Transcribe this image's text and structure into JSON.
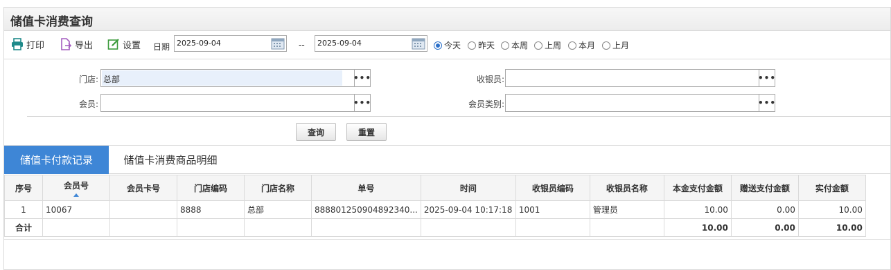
{
  "page": {
    "title": "储值卡消费查询"
  },
  "toolbar": {
    "print_label": "打印",
    "export_label": "导出",
    "settings_label": "设置",
    "date_label": "日期",
    "date_from": "2025-09-04",
    "date_separator": "--",
    "date_to": "2025-09-04",
    "ranges": [
      {
        "label": "今天",
        "selected": true
      },
      {
        "label": "昨天",
        "selected": false
      },
      {
        "label": "本周",
        "selected": false
      },
      {
        "label": "上周",
        "selected": false
      },
      {
        "label": "本月",
        "selected": false
      },
      {
        "label": "上月",
        "selected": false
      }
    ],
    "more_glyph": "•••"
  },
  "filters": {
    "store_label": "门店:",
    "store_value": "总部",
    "cashier_label": "收银员:",
    "cashier_value": "",
    "member_label": "会员:",
    "member_value": "",
    "member_type_label": "会员类别:",
    "member_type_value": ""
  },
  "actions": {
    "query_label": "查询",
    "reset_label": "重置"
  },
  "tabs": [
    {
      "label": "储值卡付款记录",
      "active": true
    },
    {
      "label": "储值卡消费商品明细",
      "active": false
    }
  ],
  "table": {
    "columns": [
      "序号",
      "会员号",
      "会员卡号",
      "门店编码",
      "门店名称",
      "单号",
      "时间",
      "收银员编码",
      "收银员名称",
      "本金支付金额",
      "赠送支付金额",
      "实付金额"
    ],
    "rows": [
      [
        "1",
        "10067",
        "",
        "8888",
        "总部",
        "888801250904892340...",
        "2025-09-04 10:17:18",
        "1001",
        "管理员",
        "10.00",
        "0.00",
        "10.00"
      ]
    ],
    "total": [
      "合计",
      "",
      "",
      "",
      "",
      "",
      "",
      "",
      "",
      "10.00",
      "0.00",
      "10.00"
    ]
  },
  "colors": {
    "accent": "#3e86d6",
    "print_icon": "#1f8a8a",
    "export_icon": "#a35bbf",
    "settings_icon": "#3a9a3a"
  }
}
